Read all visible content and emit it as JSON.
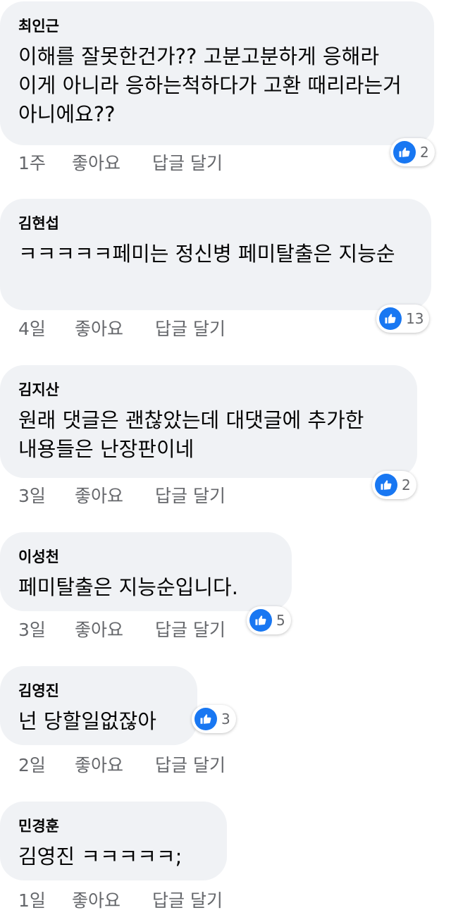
{
  "comments": [
    {
      "author": "최인근",
      "text": "이해를 잘못한건가?? 고분고분하게 응해라 이게 아니라 응하는척하다가 고환 때리라는거 아니에요??",
      "time": "1주",
      "like": "좋아요",
      "reply": "답글 달기",
      "reactions": "2"
    },
    {
      "author": "김현섭",
      "text": "ㅋㅋㅋㅋㅋ페미는 정신병 페미탈출은 지능순",
      "time": "4일",
      "like": "좋아요",
      "reply": "답글 달기",
      "reactions": "13"
    },
    {
      "author": "김지산",
      "text": "원래 댓글은 괜찮았는데 대댓글에 추가한 내용들은 난장판이네",
      "time": "3일",
      "like": "좋아요",
      "reply": "답글 달기",
      "reactions": "2"
    },
    {
      "author": "이성천",
      "text": "페미탈출은 지능순입니다.",
      "time": "3일",
      "like": "좋아요",
      "reply": "답글 달기",
      "reactions": "5"
    },
    {
      "author": "김영진",
      "text": "넌 당할일없잖아",
      "time": "2일",
      "like": "좋아요",
      "reply": "답글 달기",
      "reactions": "3"
    },
    {
      "author": "민경훈",
      "text": "김영진 ㅋㅋㅋㅋㅋ;",
      "time": "1일",
      "like": "좋아요",
      "reply": "답글 달기",
      "reactions": ""
    }
  ],
  "icons": {
    "reaction": "like-thumb-icon"
  },
  "colors": {
    "bubble": "#f0f2f5",
    "like_blue": "#1877f2",
    "meta_gray": "#65676b"
  }
}
